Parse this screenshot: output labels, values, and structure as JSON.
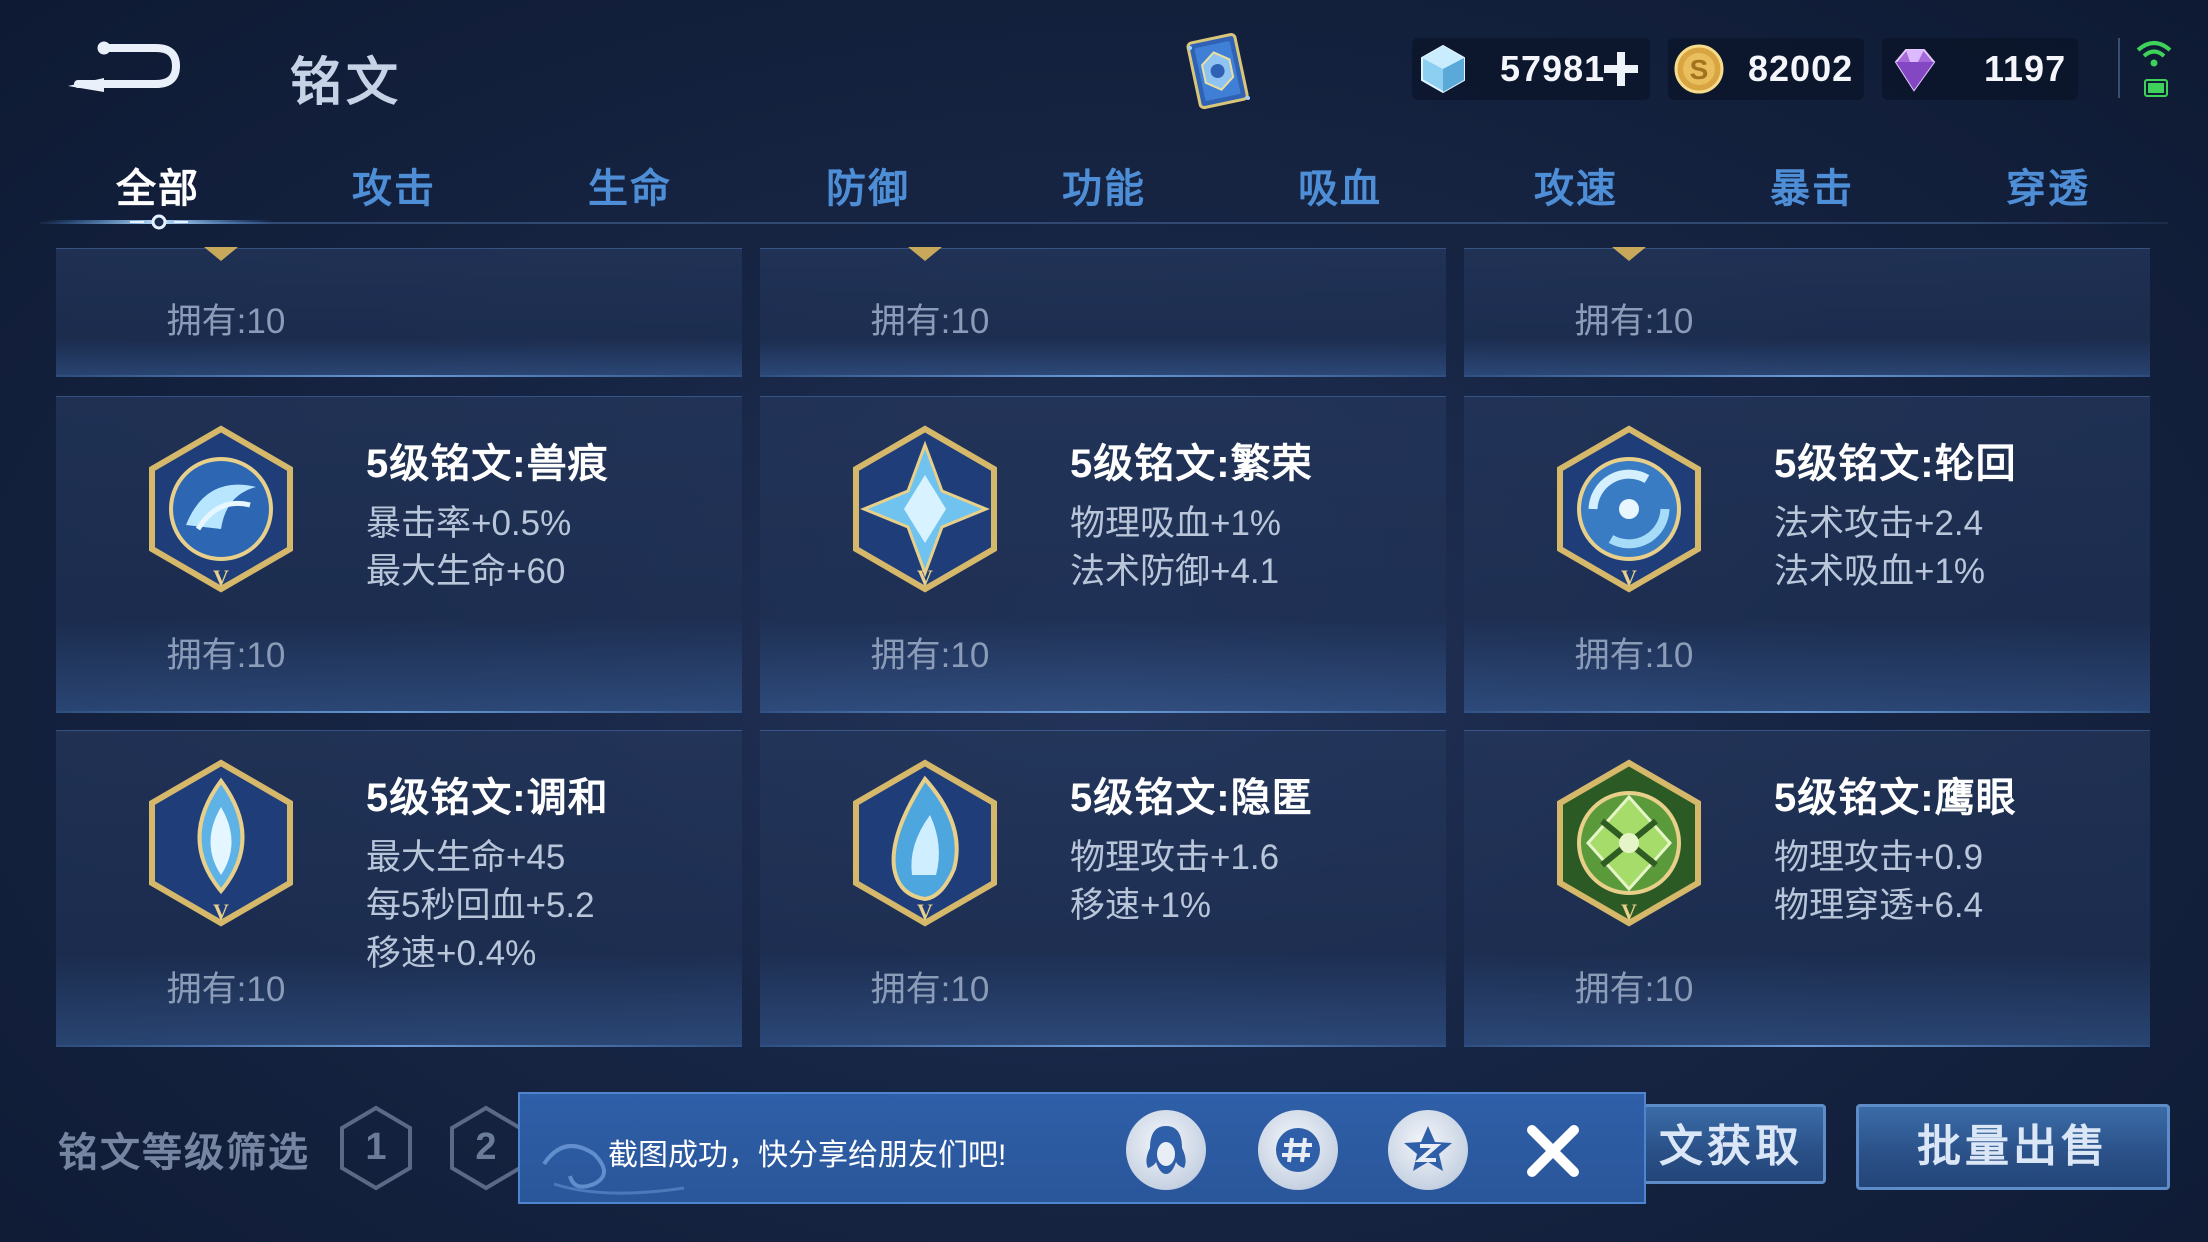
{
  "header": {
    "title": "铭文",
    "currencies": [
      {
        "icon": "diamond-icon",
        "value": "57981"
      },
      {
        "icon": "gold-coin-icon",
        "value": "82002"
      },
      {
        "icon": "purple-gem-icon",
        "value": "1197"
      }
    ]
  },
  "tabs": [
    {
      "label": "全部",
      "active": true
    },
    {
      "label": "攻击"
    },
    {
      "label": "生命"
    },
    {
      "label": "防御"
    },
    {
      "label": "功能"
    },
    {
      "label": "吸血"
    },
    {
      "label": "攻速"
    },
    {
      "label": "暴击"
    },
    {
      "label": "穿透"
    }
  ],
  "top_row_owned": [
    "拥有:10",
    "拥有:10",
    "拥有:10"
  ],
  "runes": [
    {
      "name": "5级铭文:兽痕",
      "stats": [
        "暴击率+0.5%",
        "最大生命+60"
      ],
      "owned": "拥有:10",
      "color": "blue"
    },
    {
      "name": "5级铭文:繁荣",
      "stats": [
        "物理吸血+1%",
        "法术防御+4.1"
      ],
      "owned": "拥有:10",
      "color": "blue"
    },
    {
      "name": "5级铭文:轮回",
      "stats": [
        "法术攻击+2.4",
        "法术吸血+1%"
      ],
      "owned": "拥有:10",
      "color": "blue"
    },
    {
      "name": "5级铭文:调和",
      "stats": [
        "最大生命+45",
        "每5秒回血+5.2",
        "移速+0.4%"
      ],
      "owned": "拥有:10",
      "color": "blue"
    },
    {
      "name": "5级铭文:隐匿",
      "stats": [
        "物理攻击+1.6",
        "移速+1%"
      ],
      "owned": "拥有:10",
      "color": "blue"
    },
    {
      "name": "5级铭文:鹰眼",
      "stats": [
        "物理攻击+0.9",
        "物理穿透+6.4"
      ],
      "owned": "拥有:10",
      "color": "green"
    }
  ],
  "bottom": {
    "filter_label": "铭文等级筛选",
    "levels": [
      "1",
      "2"
    ],
    "obtain_label": "文获取",
    "sell_label": "批量出售"
  },
  "toast": {
    "message": "截图成功，快分享给朋友们吧!"
  }
}
